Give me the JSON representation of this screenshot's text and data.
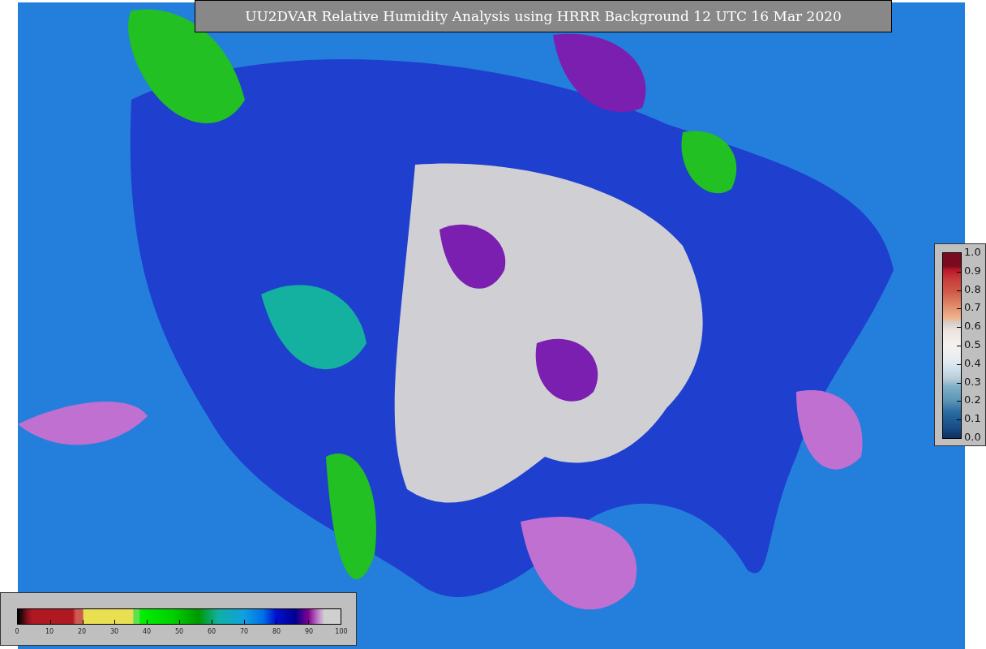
{
  "title": "UU2DVAR Relative Humidity Analysis using HRRR Background 12 UTC 16 Mar 2020",
  "station_colorbar": {
    "ticks": [
      "1.0",
      "0.9",
      "0.8",
      "0.7",
      "0.6",
      "0.5",
      "0.4",
      "0.3",
      "0.2",
      "0.1",
      "0.0"
    ]
  },
  "humidity_colorbar": {
    "ticks": [
      "0",
      "10",
      "20",
      "30",
      "40",
      "50",
      "60",
      "70",
      "80",
      "90",
      "100"
    ]
  }
}
